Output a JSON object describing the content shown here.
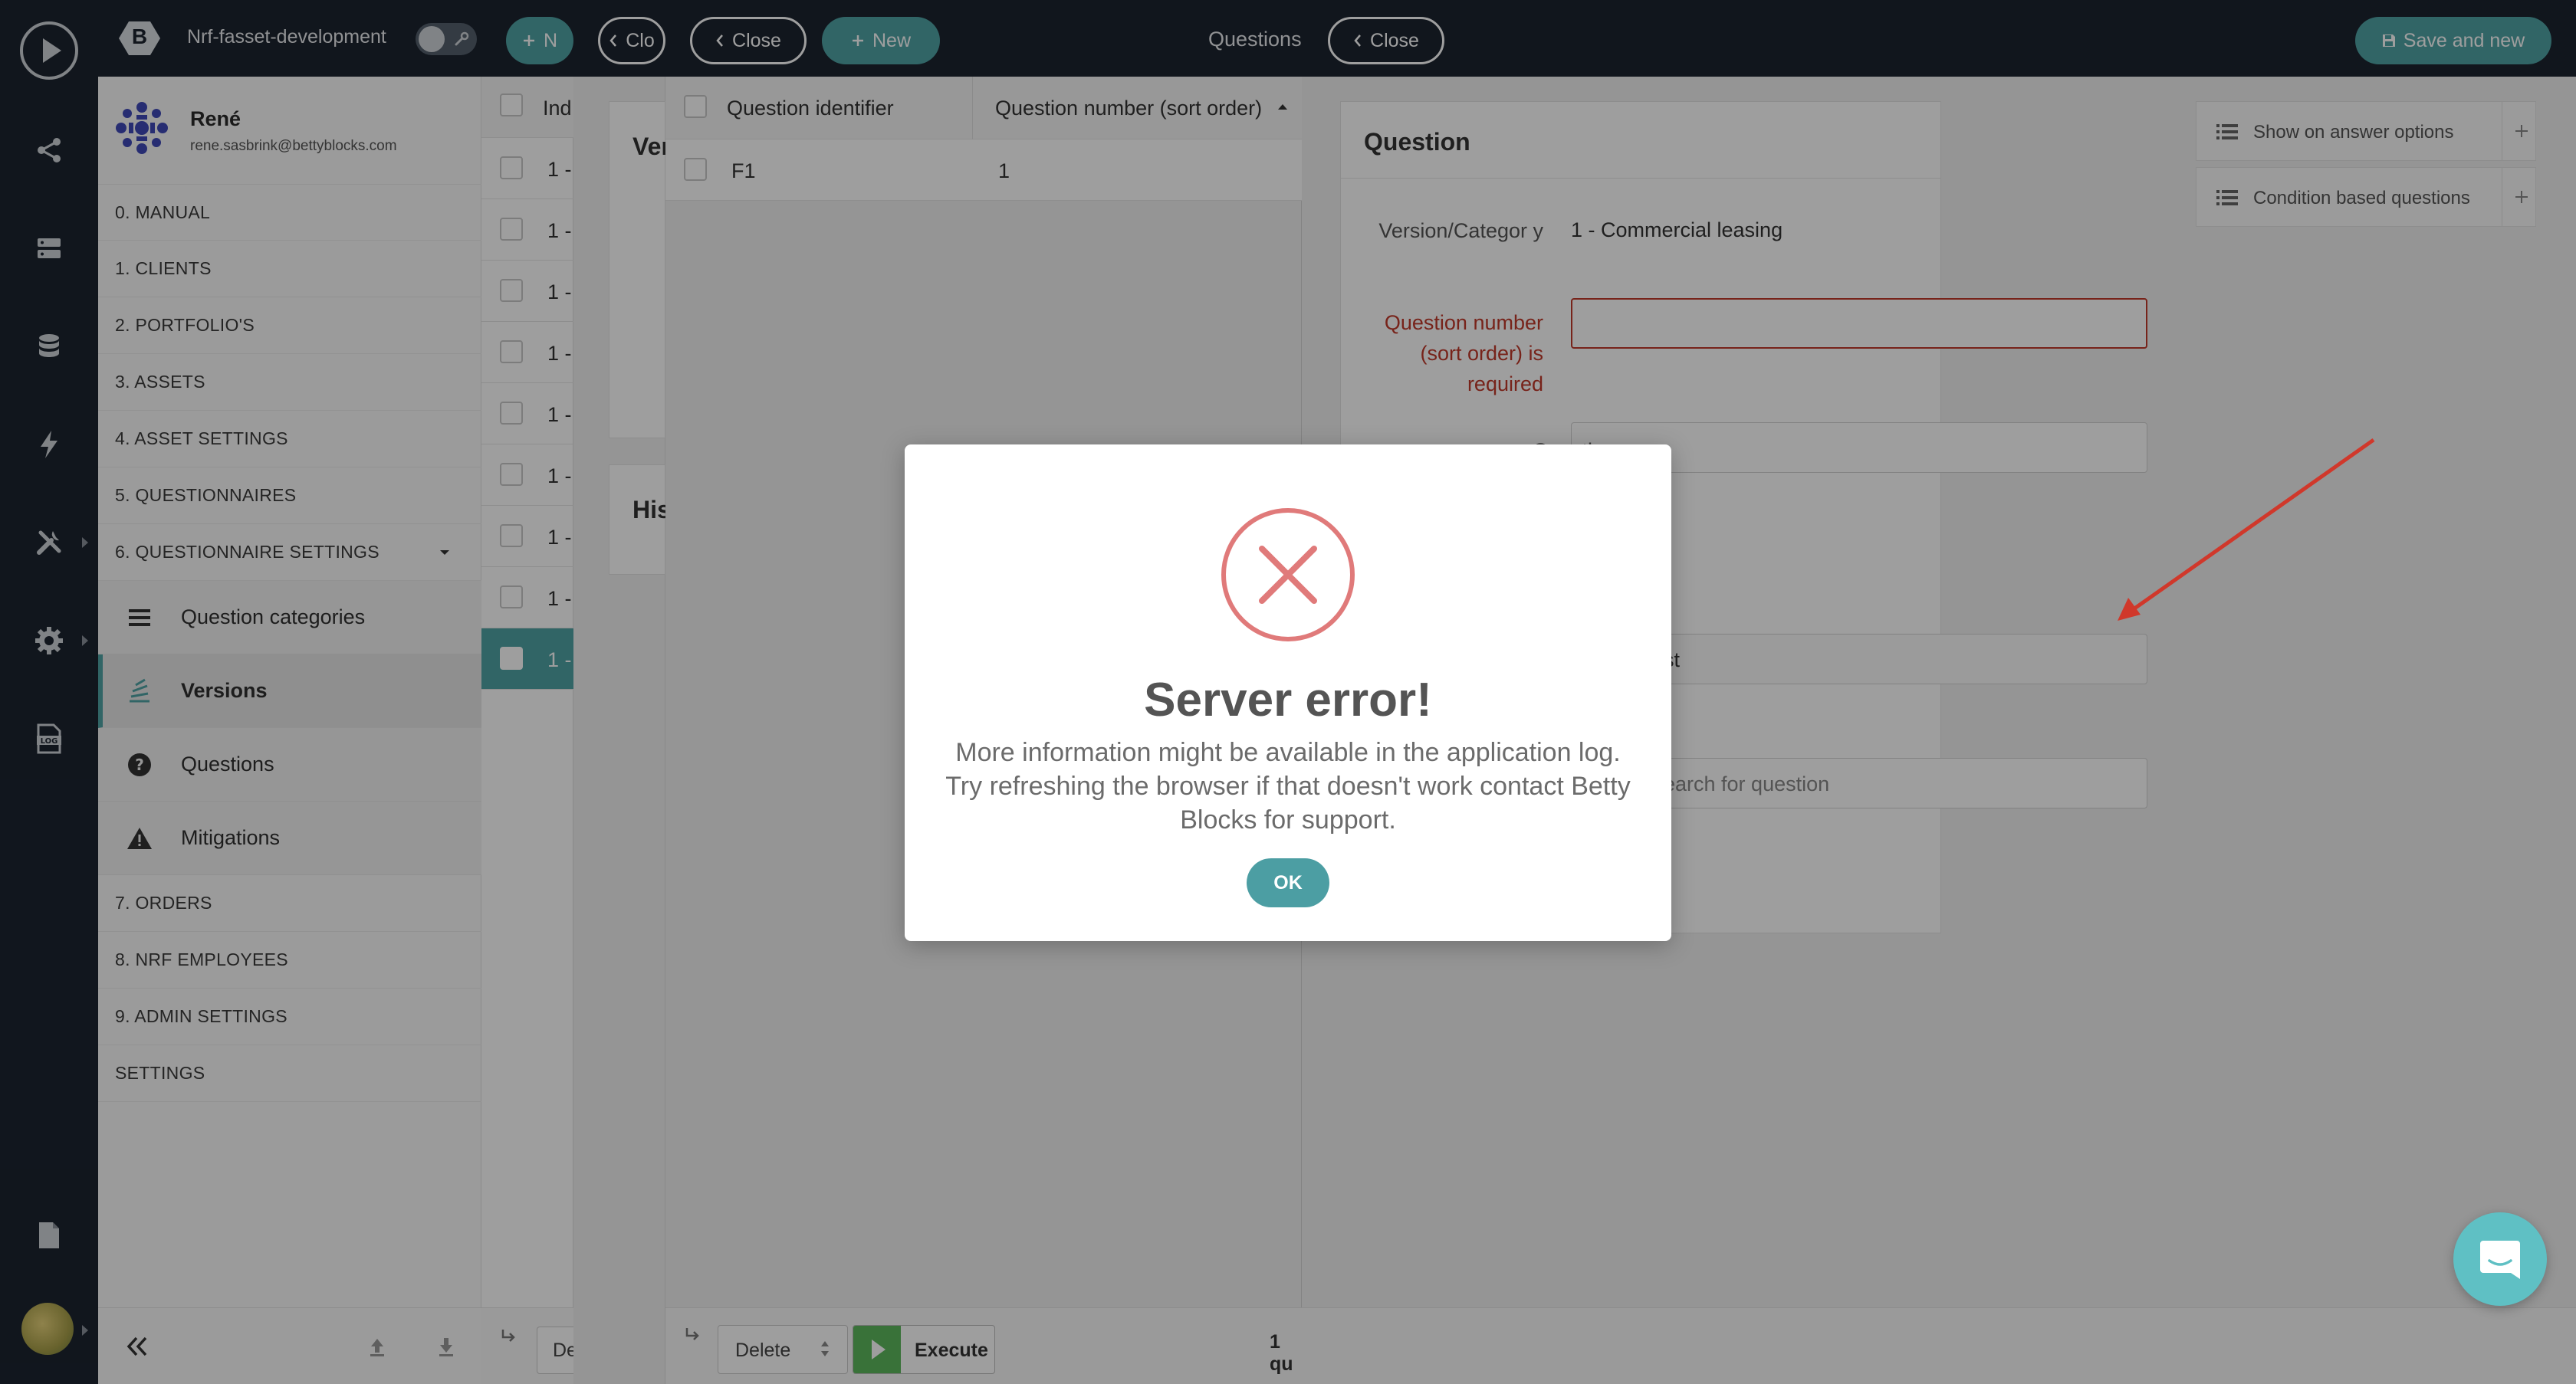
{
  "app": {
    "logo_letter": "B",
    "name": "Nrf-fasset-development"
  },
  "user": {
    "name": "René",
    "email": "rene.sasbrink@bettyblocks.com"
  },
  "nav": {
    "items": [
      {
        "label": "0. MANUAL"
      },
      {
        "label": "1. CLIENTS"
      },
      {
        "label": "2. PORTFOLIO'S"
      },
      {
        "label": "3. ASSETS"
      },
      {
        "label": "4. ASSET SETTINGS"
      },
      {
        "label": "5. QUESTIONNAIRES"
      },
      {
        "label": "6. QUESTIONNAIRE SETTINGS"
      }
    ],
    "subitems": [
      {
        "label": "Question categories",
        "icon": "list-icon"
      },
      {
        "label": "Versions",
        "icon": "stack-icon"
      },
      {
        "label": "Questions",
        "icon": "question-circle-icon"
      },
      {
        "label": "Mitigations",
        "icon": "warning-icon"
      }
    ],
    "items_after": [
      {
        "label": "7. ORDERS"
      },
      {
        "label": "8. NRF EMPLOYEES"
      },
      {
        "label": "9. ADMIN SETTINGS"
      },
      {
        "label": "SETTINGS"
      }
    ]
  },
  "panel1": {
    "new_label": "N",
    "header_col": "Ind",
    "rows": [
      "1 -",
      "1 -",
      "1 -",
      "1 -",
      "1 -",
      "1 -",
      "1 -",
      "1 -",
      "1 -"
    ],
    "footer_action": "De"
  },
  "panel2": {
    "close_label": "Clo",
    "card1_title": "Ver",
    "card2_title": "His"
  },
  "panel3": {
    "title": "Questions",
    "close_label": "Close",
    "new_label": "New",
    "col_identifier": "Question identifier",
    "col_number": "Question number (sort order)",
    "rows": [
      {
        "identifier": "F1",
        "number": "1"
      }
    ],
    "footer_action": "Delete",
    "execute_label": "Execute",
    "count_text": "1 qu"
  },
  "form": {
    "close_label": "Close",
    "save_new_label": "Save and new",
    "title": "Question",
    "version_label": "Version/Categor y",
    "version_value": "1 - Commercial leasing",
    "number_error_label": "Question number (sort order) is required",
    "question_label_partial": "Question",
    "type_label_partial": "er",
    "type_value_partial": "st",
    "search_placeholder": "earch for question"
  },
  "right_panel": {
    "items": [
      {
        "label": "Show on answer options"
      },
      {
        "label": "Condition based questions"
      }
    ]
  },
  "modal": {
    "title": "Server error!",
    "message": "More information might be available in the application log. Try refreshing the browser if that doesn't work contact Betty Blocks for support.",
    "ok_label": "OK"
  },
  "colors": {
    "accent_teal": "#4fa3a5",
    "error_red": "#c0392b",
    "modal_icon_red": "#e07a7a",
    "dark_bar": "#1c2430",
    "execute_green": "#5cb85c"
  }
}
